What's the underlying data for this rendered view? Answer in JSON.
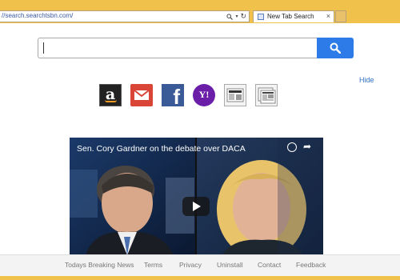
{
  "browser": {
    "address": "//search.searchtsbn.com/",
    "tab_title": "New Tab Search",
    "tab_close": "×"
  },
  "search": {
    "placeholder": "",
    "value": ""
  },
  "hide_label": "Hide",
  "shortcuts": [
    {
      "name": "Amazon",
      "glyph": "a",
      "icon": "amazon-icon"
    },
    {
      "name": "Gmail",
      "icon": "gmail-icon"
    },
    {
      "name": "Facebook",
      "glyph": "f",
      "icon": "facebook-icon"
    },
    {
      "name": "Yahoo",
      "glyph": "Y!",
      "icon": "yahoo-icon"
    },
    {
      "name": "News 1",
      "icon": "newspaper-icon"
    },
    {
      "name": "News 2",
      "icon": "newspaper-icon"
    }
  ],
  "video": {
    "title": "Sen. Cory Gardner on the debate over DACA"
  },
  "footer": {
    "links": [
      "Todays Breaking News",
      "Terms",
      "Privacy",
      "Uninstall",
      "Contact",
      "Feedback"
    ]
  },
  "colors": {
    "accent": "#2d7be8",
    "chrome": "#f0c24b"
  }
}
